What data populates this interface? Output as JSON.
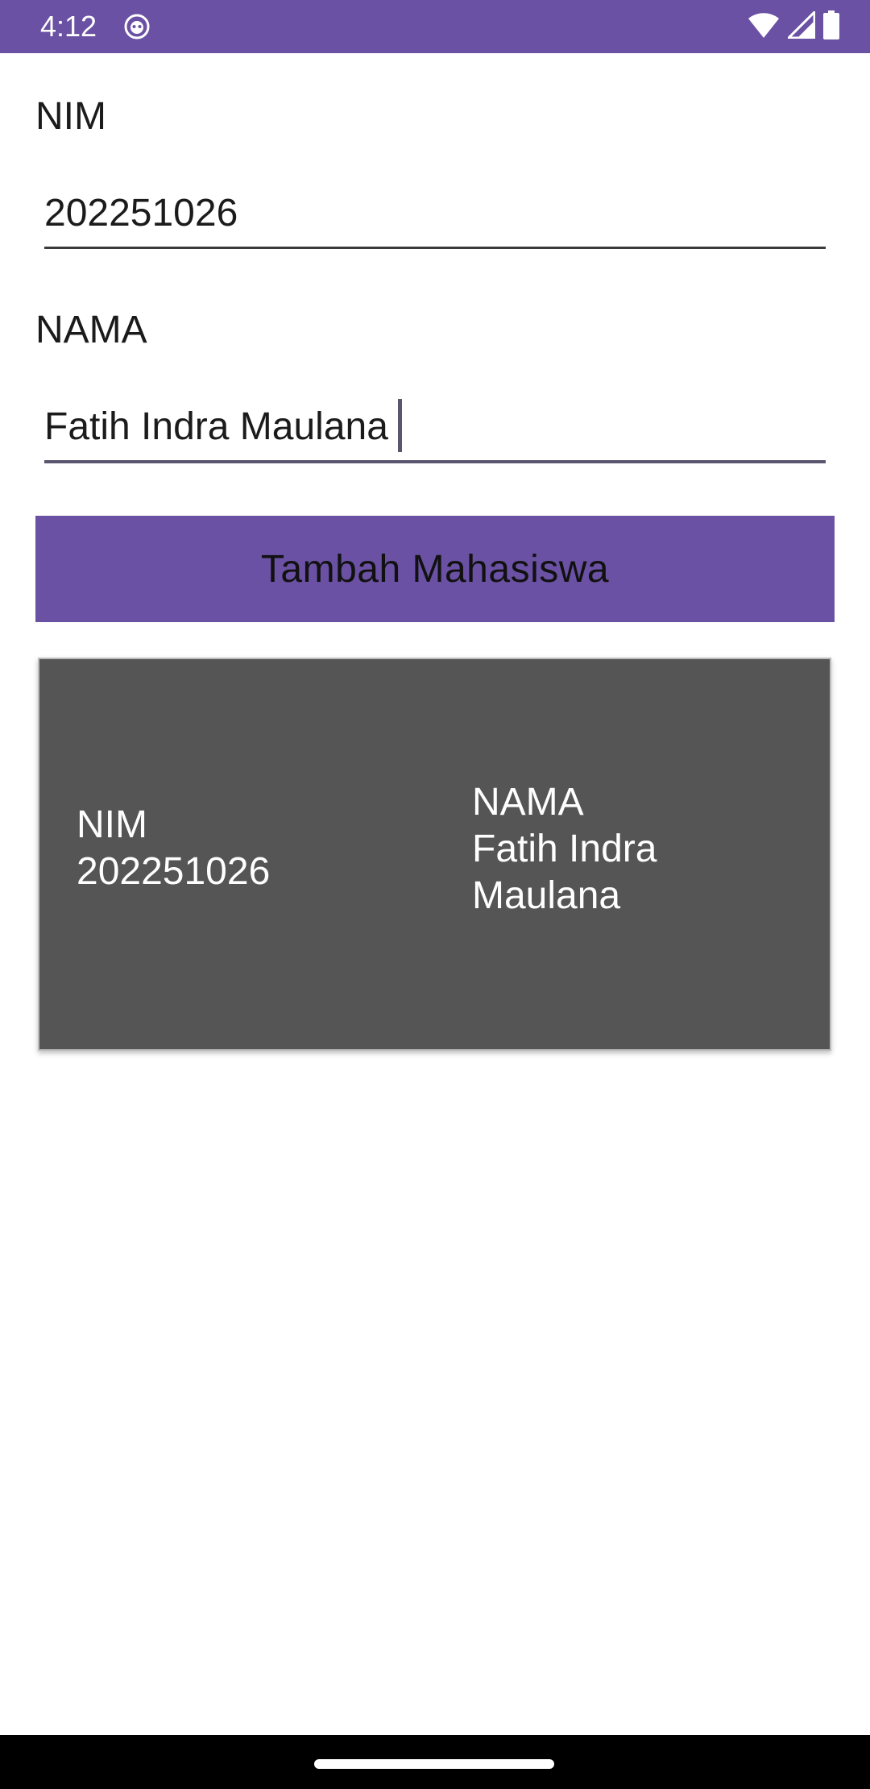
{
  "status_bar": {
    "time": "4:12",
    "bg_color": "#6a51a3",
    "icons": [
      "app-notification-icon",
      "wifi-icon",
      "signal-icon",
      "battery-icon"
    ]
  },
  "form": {
    "nim_label": "NIM",
    "nim_value": "202251026",
    "nama_label": "NAMA",
    "nama_value": "Fatih Indra Maulana",
    "submit_label": "Tambah Mahasiswa",
    "accent_color": "#6a51a3"
  },
  "student_list": {
    "items": [
      {
        "nim_label": "NIM",
        "nim_value": "202251026",
        "nama_label": "NAMA",
        "nama_value": "Fatih Indra Maulana"
      }
    ],
    "card_color": "#555555"
  }
}
